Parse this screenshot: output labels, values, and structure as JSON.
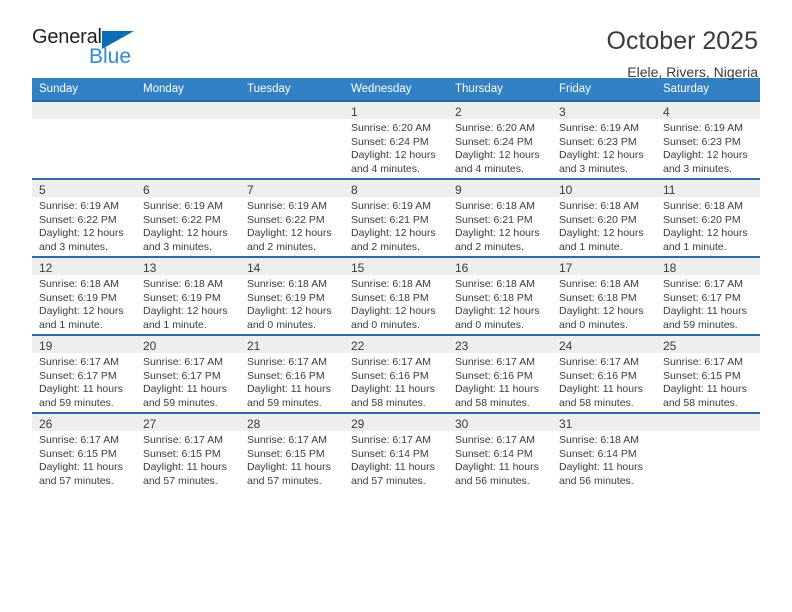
{
  "brand": {
    "name_top": "General",
    "name_bottom": "Blue",
    "triangle_color": "#0b6cb8",
    "text_color": "#231f20",
    "bottom_color": "#2e8bd4"
  },
  "header": {
    "title": "October 2025",
    "subtitle": "Elele, Rivers, Nigeria"
  },
  "theme": {
    "header_row_bg": "#3281c4",
    "row_top_border": "#2b6ca8",
    "daynum_strip_bg": "#eeeeee",
    "text": "#3b3b3b"
  },
  "weekdays": [
    "Sunday",
    "Monday",
    "Tuesday",
    "Wednesday",
    "Thursday",
    "Friday",
    "Saturday"
  ],
  "weeks": [
    [
      {
        "day": "",
        "lines": []
      },
      {
        "day": "",
        "lines": []
      },
      {
        "day": "",
        "lines": []
      },
      {
        "day": "1",
        "lines": [
          "Sunrise: 6:20 AM",
          "Sunset: 6:24 PM",
          "Daylight: 12 hours",
          "and 4 minutes."
        ]
      },
      {
        "day": "2",
        "lines": [
          "Sunrise: 6:20 AM",
          "Sunset: 6:24 PM",
          "Daylight: 12 hours",
          "and 4 minutes."
        ]
      },
      {
        "day": "3",
        "lines": [
          "Sunrise: 6:19 AM",
          "Sunset: 6:23 PM",
          "Daylight: 12 hours",
          "and 3 minutes."
        ]
      },
      {
        "day": "4",
        "lines": [
          "Sunrise: 6:19 AM",
          "Sunset: 6:23 PM",
          "Daylight: 12 hours",
          "and 3 minutes."
        ]
      }
    ],
    [
      {
        "day": "5",
        "lines": [
          "Sunrise: 6:19 AM",
          "Sunset: 6:22 PM",
          "Daylight: 12 hours",
          "and 3 minutes."
        ]
      },
      {
        "day": "6",
        "lines": [
          "Sunrise: 6:19 AM",
          "Sunset: 6:22 PM",
          "Daylight: 12 hours",
          "and 3 minutes."
        ]
      },
      {
        "day": "7",
        "lines": [
          "Sunrise: 6:19 AM",
          "Sunset: 6:22 PM",
          "Daylight: 12 hours",
          "and 2 minutes."
        ]
      },
      {
        "day": "8",
        "lines": [
          "Sunrise: 6:19 AM",
          "Sunset: 6:21 PM",
          "Daylight: 12 hours",
          "and 2 minutes."
        ]
      },
      {
        "day": "9",
        "lines": [
          "Sunrise: 6:18 AM",
          "Sunset: 6:21 PM",
          "Daylight: 12 hours",
          "and 2 minutes."
        ]
      },
      {
        "day": "10",
        "lines": [
          "Sunrise: 6:18 AM",
          "Sunset: 6:20 PM",
          "Daylight: 12 hours",
          "and 1 minute."
        ]
      },
      {
        "day": "11",
        "lines": [
          "Sunrise: 6:18 AM",
          "Sunset: 6:20 PM",
          "Daylight: 12 hours",
          "and 1 minute."
        ]
      }
    ],
    [
      {
        "day": "12",
        "lines": [
          "Sunrise: 6:18 AM",
          "Sunset: 6:19 PM",
          "Daylight: 12 hours",
          "and 1 minute."
        ]
      },
      {
        "day": "13",
        "lines": [
          "Sunrise: 6:18 AM",
          "Sunset: 6:19 PM",
          "Daylight: 12 hours",
          "and 1 minute."
        ]
      },
      {
        "day": "14",
        "lines": [
          "Sunrise: 6:18 AM",
          "Sunset: 6:19 PM",
          "Daylight: 12 hours",
          "and 0 minutes."
        ]
      },
      {
        "day": "15",
        "lines": [
          "Sunrise: 6:18 AM",
          "Sunset: 6:18 PM",
          "Daylight: 12 hours",
          "and 0 minutes."
        ]
      },
      {
        "day": "16",
        "lines": [
          "Sunrise: 6:18 AM",
          "Sunset: 6:18 PM",
          "Daylight: 12 hours",
          "and 0 minutes."
        ]
      },
      {
        "day": "17",
        "lines": [
          "Sunrise: 6:18 AM",
          "Sunset: 6:18 PM",
          "Daylight: 12 hours",
          "and 0 minutes."
        ]
      },
      {
        "day": "18",
        "lines": [
          "Sunrise: 6:17 AM",
          "Sunset: 6:17 PM",
          "Daylight: 11 hours",
          "and 59 minutes."
        ]
      }
    ],
    [
      {
        "day": "19",
        "lines": [
          "Sunrise: 6:17 AM",
          "Sunset: 6:17 PM",
          "Daylight: 11 hours",
          "and 59 minutes."
        ]
      },
      {
        "day": "20",
        "lines": [
          "Sunrise: 6:17 AM",
          "Sunset: 6:17 PM",
          "Daylight: 11 hours",
          "and 59 minutes."
        ]
      },
      {
        "day": "21",
        "lines": [
          "Sunrise: 6:17 AM",
          "Sunset: 6:16 PM",
          "Daylight: 11 hours",
          "and 59 minutes."
        ]
      },
      {
        "day": "22",
        "lines": [
          "Sunrise: 6:17 AM",
          "Sunset: 6:16 PM",
          "Daylight: 11 hours",
          "and 58 minutes."
        ]
      },
      {
        "day": "23",
        "lines": [
          "Sunrise: 6:17 AM",
          "Sunset: 6:16 PM",
          "Daylight: 11 hours",
          "and 58 minutes."
        ]
      },
      {
        "day": "24",
        "lines": [
          "Sunrise: 6:17 AM",
          "Sunset: 6:16 PM",
          "Daylight: 11 hours",
          "and 58 minutes."
        ]
      },
      {
        "day": "25",
        "lines": [
          "Sunrise: 6:17 AM",
          "Sunset: 6:15 PM",
          "Daylight: 11 hours",
          "and 58 minutes."
        ]
      }
    ],
    [
      {
        "day": "26",
        "lines": [
          "Sunrise: 6:17 AM",
          "Sunset: 6:15 PM",
          "Daylight: 11 hours",
          "and 57 minutes."
        ]
      },
      {
        "day": "27",
        "lines": [
          "Sunrise: 6:17 AM",
          "Sunset: 6:15 PM",
          "Daylight: 11 hours",
          "and 57 minutes."
        ]
      },
      {
        "day": "28",
        "lines": [
          "Sunrise: 6:17 AM",
          "Sunset: 6:15 PM",
          "Daylight: 11 hours",
          "and 57 minutes."
        ]
      },
      {
        "day": "29",
        "lines": [
          "Sunrise: 6:17 AM",
          "Sunset: 6:14 PM",
          "Daylight: 11 hours",
          "and 57 minutes."
        ]
      },
      {
        "day": "30",
        "lines": [
          "Sunrise: 6:17 AM",
          "Sunset: 6:14 PM",
          "Daylight: 11 hours",
          "and 56 minutes."
        ]
      },
      {
        "day": "31",
        "lines": [
          "Sunrise: 6:18 AM",
          "Sunset: 6:14 PM",
          "Daylight: 11 hours",
          "and 56 minutes."
        ]
      },
      {
        "day": "",
        "lines": []
      }
    ]
  ]
}
